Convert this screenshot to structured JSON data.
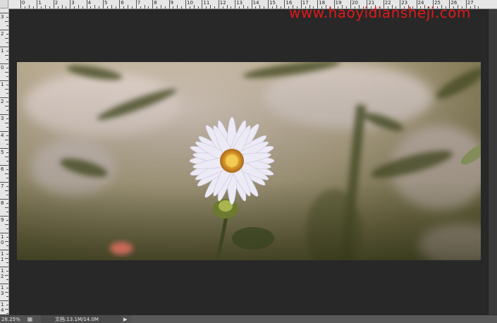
{
  "watermark": "www.haoyidiansheji.com",
  "ruler_top_labels": [
    "0",
    "1",
    "2",
    "3",
    "4",
    "5",
    "6",
    "7",
    "8",
    "9",
    "10",
    "11",
    "12",
    "13",
    "14",
    "15",
    "16",
    "17",
    "18",
    "19",
    "20",
    "21",
    "22",
    "23",
    "24",
    "25",
    "26",
    "27"
  ],
  "ruler_left_labels": [
    "3",
    "2",
    "1",
    "0",
    "1",
    "2",
    "3",
    "4",
    "5",
    "6",
    "7",
    "8",
    "9",
    "10",
    "11",
    "12",
    "13",
    "14"
  ],
  "status": {
    "zoom": "28.25%",
    "doc_info": "文档:13.1M/14.0M",
    "arrow": "▶"
  },
  "colors": {
    "watermark": "#e0191a",
    "workspace": "#282828",
    "ruler": "#e6e6e6",
    "statusbar": "#535353"
  },
  "icons": {
    "status": "document-icon",
    "arrow": "arrow-right-icon"
  }
}
